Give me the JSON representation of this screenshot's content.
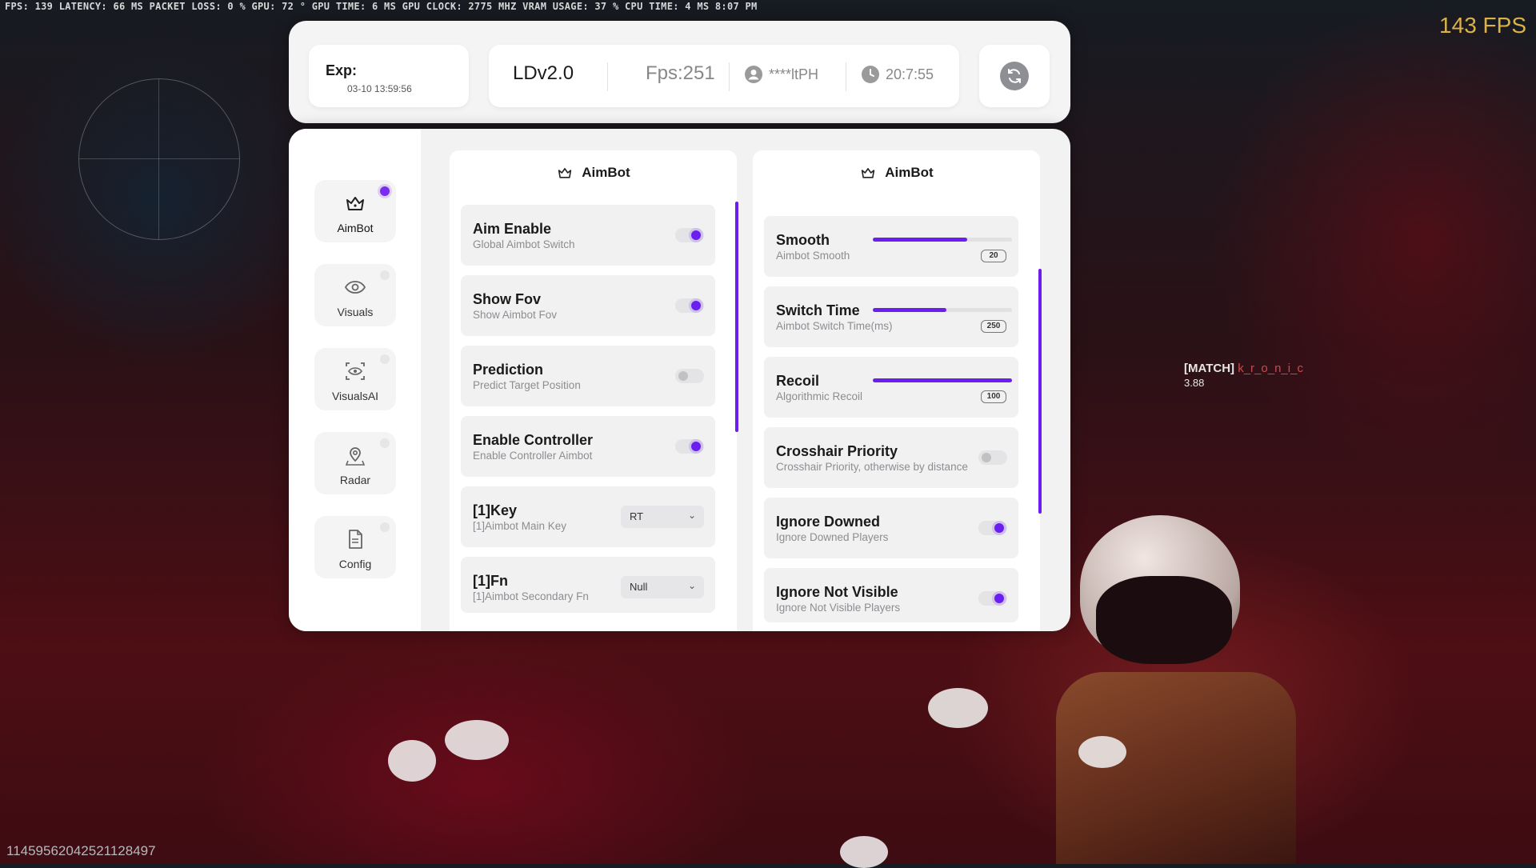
{
  "overlay": {
    "stats_line": "FPS: 139  LATENCY: 66 MS  PACKET LOSS: 0 %  GPU: 72 °  GPU TIME: 6 MS  GPU CLOCK: 2775 MHZ  VRAM USAGE: 37 %  CPU TIME: 4 MS  8:07 PM",
    "fps_counter": "143 FPS",
    "bottom_id": "1145956204252112849​7",
    "match_tag": "[MATCH]",
    "match_player": "k_r_o_n_i_c",
    "match_score": "3.88"
  },
  "topbar": {
    "exp_label": "Exp:",
    "exp_date": "03-10 13:59:56",
    "version": "LDv2.0",
    "fps": "Fps:251",
    "user": "****ltPH",
    "time": "20:7:55"
  },
  "sidebar": {
    "items": [
      {
        "label": "AimBot",
        "icon": "crown-icon",
        "active": true
      },
      {
        "label": "Visuals",
        "icon": "eye-icon",
        "active": false
      },
      {
        "label": "VisualsAI",
        "icon": "scan-eye-icon",
        "active": false
      },
      {
        "label": "Radar",
        "icon": "map-pin-icon",
        "active": false
      },
      {
        "label": "Config",
        "icon": "document-icon",
        "active": false
      }
    ]
  },
  "left_col": {
    "title": "AimBot",
    "rows": [
      {
        "title": "Aim Enable",
        "sub": "Global Aimbot Switch",
        "toggle": true
      },
      {
        "title": "Show Fov",
        "sub": "Show Aimbot Fov",
        "toggle": true
      },
      {
        "title": "Prediction",
        "sub": "Predict Target Position",
        "toggle": false
      },
      {
        "title": "Enable Controller",
        "sub": "Enable Controller Aimbot",
        "toggle": true
      },
      {
        "title": "[1]Key",
        "sub": "[1]Aimbot Main Key",
        "select": "RT"
      },
      {
        "title": "[1]Fn",
        "sub": "[1]Aimbot Secondary Fn",
        "select": "Null"
      }
    ]
  },
  "right_col": {
    "title": "AimBot",
    "sliders": [
      {
        "title": "Smooth",
        "sub": "Aimbot Smooth",
        "value": "20",
        "fill": 0.68
      },
      {
        "title": "Switch Time",
        "sub": "Aimbot Switch Time(ms)",
        "value": "250",
        "fill": 0.53
      },
      {
        "title": "Recoil",
        "sub": "Algorithmic Recoil",
        "value": "100",
        "fill": 1.0
      }
    ],
    "toggles": [
      {
        "title": "Crosshair Priority",
        "sub": "Crosshair Priority, otherwise by distance",
        "toggle": false
      },
      {
        "title": "Ignore Downed",
        "sub": "Ignore Downed Players",
        "toggle": true
      },
      {
        "title": "Ignore Not Visible",
        "sub": "Ignore Not Visible Players",
        "toggle": true
      }
    ]
  },
  "colors": {
    "accent": "#6a1ff0",
    "panel": "#f2f2f3",
    "card": "#ffffff"
  }
}
